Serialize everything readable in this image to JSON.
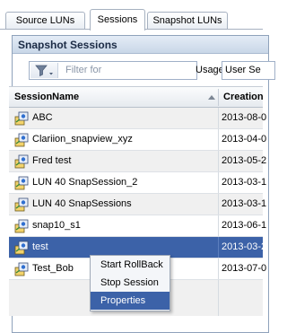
{
  "tabs": [
    {
      "label": "Source LUNs",
      "active": false
    },
    {
      "label": "Sessions",
      "active": true
    },
    {
      "label": "Snapshot LUNs",
      "active": false
    }
  ],
  "panel": {
    "title": "Snapshot Sessions",
    "filter_placeholder": "Filter for",
    "usage_label": "Usage",
    "usage_value": "User Se"
  },
  "table": {
    "columns": [
      "SessionName",
      "Creation"
    ],
    "rows": [
      {
        "name": "ABC",
        "created": "2013-08-0"
      },
      {
        "name": "Clariion_snapview_xyz",
        "created": "2013-04-0"
      },
      {
        "name": "Fred test",
        "created": "2013-05-2"
      },
      {
        "name": "LUN 40 SnapSession_2",
        "created": "2013-03-1"
      },
      {
        "name": "LUN 40 SnapSessions",
        "created": "2013-03-1"
      },
      {
        "name": "snap10_s1",
        "created": "2013-06-1"
      },
      {
        "name": "test",
        "created": "2013-03-2",
        "selected": true
      },
      {
        "name": "Test_Bob",
        "created": "2013-07-0"
      }
    ]
  },
  "context_menu": {
    "items": [
      "Start RollBack",
      "Stop Session",
      "Properties"
    ],
    "highlighted": "Properties"
  },
  "colors": {
    "selection": "#3c62a8",
    "header_gradient_top": "#e4ecf6",
    "border": "#8fa2bb"
  },
  "icons": {
    "row_icon": "snapshot-session-icon",
    "filter_icon": "funnel-icon",
    "sort_icon": "sort-ascending-icon"
  }
}
